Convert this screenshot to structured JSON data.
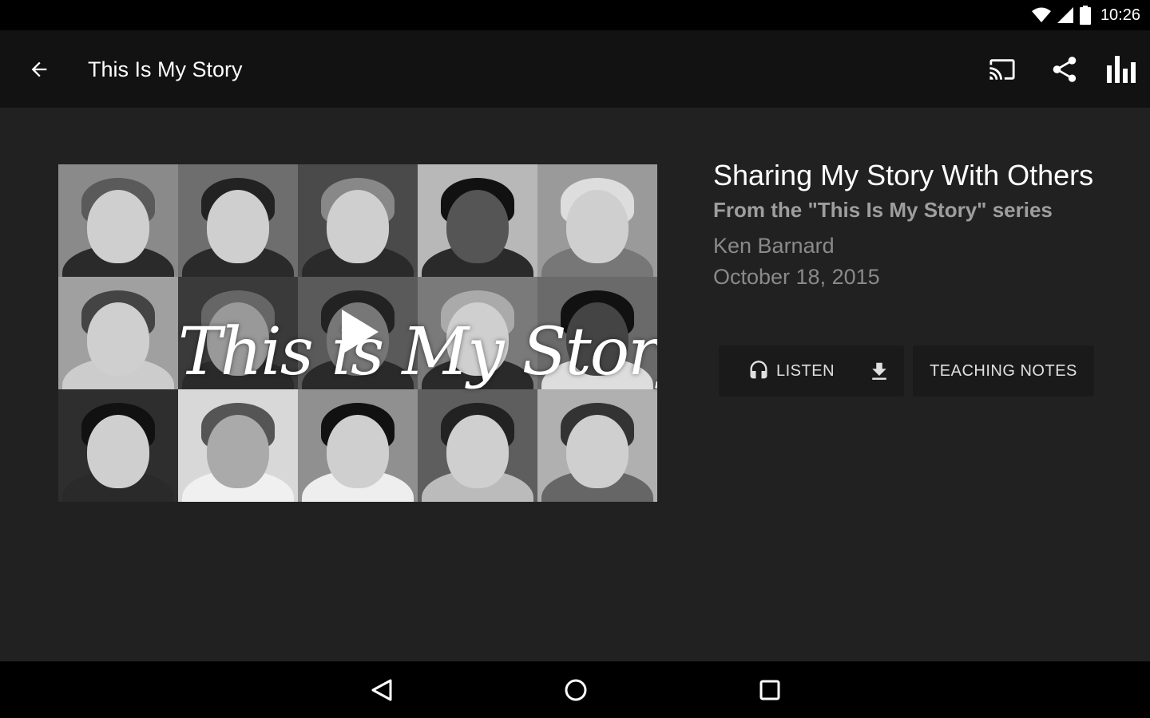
{
  "status_bar": {
    "time": "10:26",
    "icons": [
      "wifi-icon",
      "cell-signal-icon",
      "battery-icon"
    ]
  },
  "app_bar": {
    "title": "This Is My Story",
    "actions": [
      "cast-icon",
      "share-icon",
      "equalizer-icon"
    ]
  },
  "media": {
    "overlay_text": "This is My Story"
  },
  "details": {
    "title": "Sharing My Story With Others",
    "series": "From the \"This Is My Story\" series",
    "speaker": "Ken Barnard",
    "date": "October 18, 2015"
  },
  "buttons": {
    "listen_label": "LISTEN",
    "notes_label": "TEACHING NOTES"
  },
  "nav_bar": {
    "buttons": [
      "back-triangle-icon",
      "home-circle-icon",
      "recents-square-icon"
    ]
  },
  "colors": {
    "background": "#212121",
    "app_bar": "#121212",
    "system_bar": "#000000",
    "secondary_text": "#9e9e9e"
  }
}
